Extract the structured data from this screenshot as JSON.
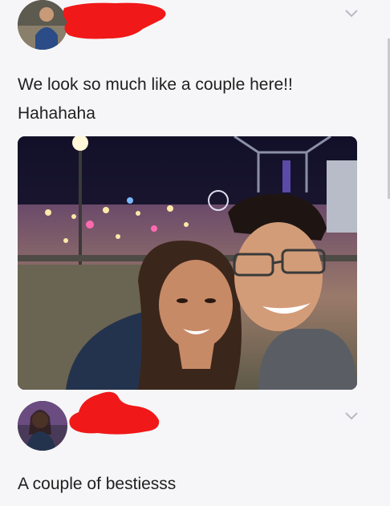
{
  "post1": {
    "avatar_alt": "profile photo",
    "caption_line1": "We look so much like a couple here!!",
    "caption_line2": "Hahahaha",
    "photo_alt": "selfie at a night carnival"
  },
  "post2": {
    "avatar_alt": "profile photo",
    "caption": "A couple of bestiesss"
  },
  "colors": {
    "redaction": "#f01818",
    "background": "#f6f6f8",
    "chevron": "#b9b9c6"
  }
}
